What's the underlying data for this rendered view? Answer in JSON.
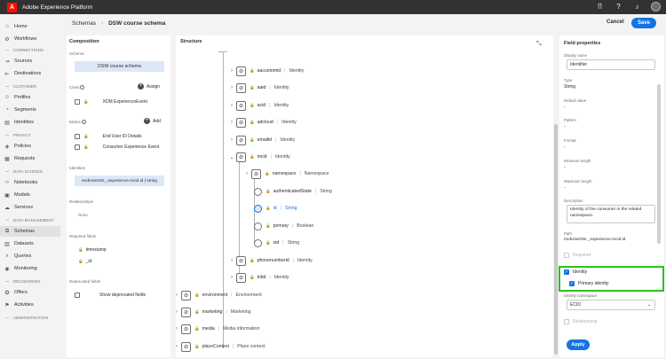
{
  "app": {
    "title": "Adobe Experience Platform",
    "logo_letter": "A"
  },
  "topbar_icons": [
    "apps-icon",
    "help-icon",
    "bell-icon",
    "avatar"
  ],
  "sidebar": {
    "items_top": [
      {
        "label": "Home",
        "icon": "⌂"
      },
      {
        "label": "Workflows",
        "icon": "⚙"
      }
    ],
    "sections": [
      {
        "title": "CONNECTIONS",
        "items": [
          {
            "label": "Sources",
            "icon": "⇥"
          },
          {
            "label": "Destinations",
            "icon": "⇤"
          }
        ]
      },
      {
        "title": "CUSTOMER",
        "items": [
          {
            "label": "Profiles",
            "icon": "☺"
          },
          {
            "label": "Segments",
            "icon": "◔"
          },
          {
            "label": "Identities",
            "icon": "▤"
          }
        ]
      },
      {
        "title": "PRIVACY",
        "items": [
          {
            "label": "Policies",
            "icon": "◈"
          },
          {
            "label": "Requests",
            "icon": "▦"
          }
        ]
      },
      {
        "title": "DATA SCIENCE",
        "items": [
          {
            "label": "Notebooks",
            "icon": "‹›"
          },
          {
            "label": "Models",
            "icon": "▣"
          },
          {
            "label": "Services",
            "icon": "☁"
          }
        ]
      },
      {
        "title": "DATA MANAGEMENT",
        "items": [
          {
            "label": "Schemas",
            "icon": "⧉",
            "active": true
          },
          {
            "label": "Datasets",
            "icon": "▥"
          },
          {
            "label": "Queries",
            "icon": "⌕"
          },
          {
            "label": "Monitoring",
            "icon": "◉"
          }
        ]
      },
      {
        "title": "DECISIONING",
        "items": [
          {
            "label": "Offers",
            "icon": "✪"
          },
          {
            "label": "Activities",
            "icon": "⚑"
          }
        ]
      },
      {
        "title": "ADMINISTRATION",
        "items": []
      }
    ]
  },
  "breadcrumb": {
    "root": "Schemas",
    "separator": "›",
    "current": "DSW course schema"
  },
  "actions": {
    "cancel": "Cancel",
    "save": "Save"
  },
  "composition": {
    "title": "Composition",
    "schema_label": "Schema",
    "schema_value": "DSW course schema",
    "class_label": "Class",
    "assign": "Assign",
    "class_value": "XDM ExperienceEvent",
    "mixins_label": "Mixins",
    "add": "Add",
    "mixins": [
      "End User ID Details",
      "Consumer Experience Event"
    ],
    "identities_label": "Identities",
    "identity_value": "endUserIDs._experience.mcid.id | string",
    "relationships_label": "Relationships",
    "relationships_value": "None",
    "required_label": "Required fields",
    "required": [
      "timestamp",
      "_id"
    ],
    "deprecated_label": "Deprecated fields",
    "show_deprecated": "Show deprecated fields"
  },
  "structure": {
    "title": "Structure",
    "rows": [
      {
        "name": "aacustomid",
        "type": "Identity"
      },
      {
        "name": "aaid",
        "type": "Identity"
      },
      {
        "name": "acid",
        "type": "Identity"
      },
      {
        "name": "adcloud",
        "type": "Identity"
      },
      {
        "name": "emailid",
        "type": "Identity"
      },
      {
        "name": "mcid",
        "type": "Identity"
      },
      {
        "name": "namespace",
        "type": "Namespace"
      },
      {
        "name": "authenticatedState",
        "type": "String"
      },
      {
        "name": "id",
        "type": "String"
      },
      {
        "name": "primary",
        "type": "Boolean"
      },
      {
        "name": "xid",
        "type": "String"
      },
      {
        "name": "phonenumberid",
        "type": "Identity"
      },
      {
        "name": "tntid",
        "type": "Identity"
      },
      {
        "name": "environment",
        "type": "Environment"
      },
      {
        "name": "marketing",
        "type": "Marketing"
      },
      {
        "name": "media",
        "type": "Media information"
      },
      {
        "name": "placeContext",
        "type": "Place context"
      }
    ]
  },
  "properties": {
    "title": "Field properties",
    "display_name_label": "Display name",
    "display_name": "Identifier",
    "type_label": "Type",
    "type": "String",
    "default_label": "Default value",
    "default_value": "-",
    "pattern_label": "Pattern",
    "pattern": "-",
    "format_label": "Format",
    "format": "-",
    "minlen_label": "Minimum length",
    "minlen": "-",
    "maxlen_label": "Maximum length",
    "maxlen": "-",
    "description_label": "Description",
    "description": "Identity of the consumer in the related namespace.",
    "path_label": "Path",
    "path": "endUserIDs._experience.mcid.id",
    "required": "Required",
    "identity": "Identity",
    "primary_identity": "Primary identity",
    "namespace_label": "Identity namespace",
    "namespace_value": "ECID",
    "relationship": "Relationship",
    "apply": "Apply"
  }
}
